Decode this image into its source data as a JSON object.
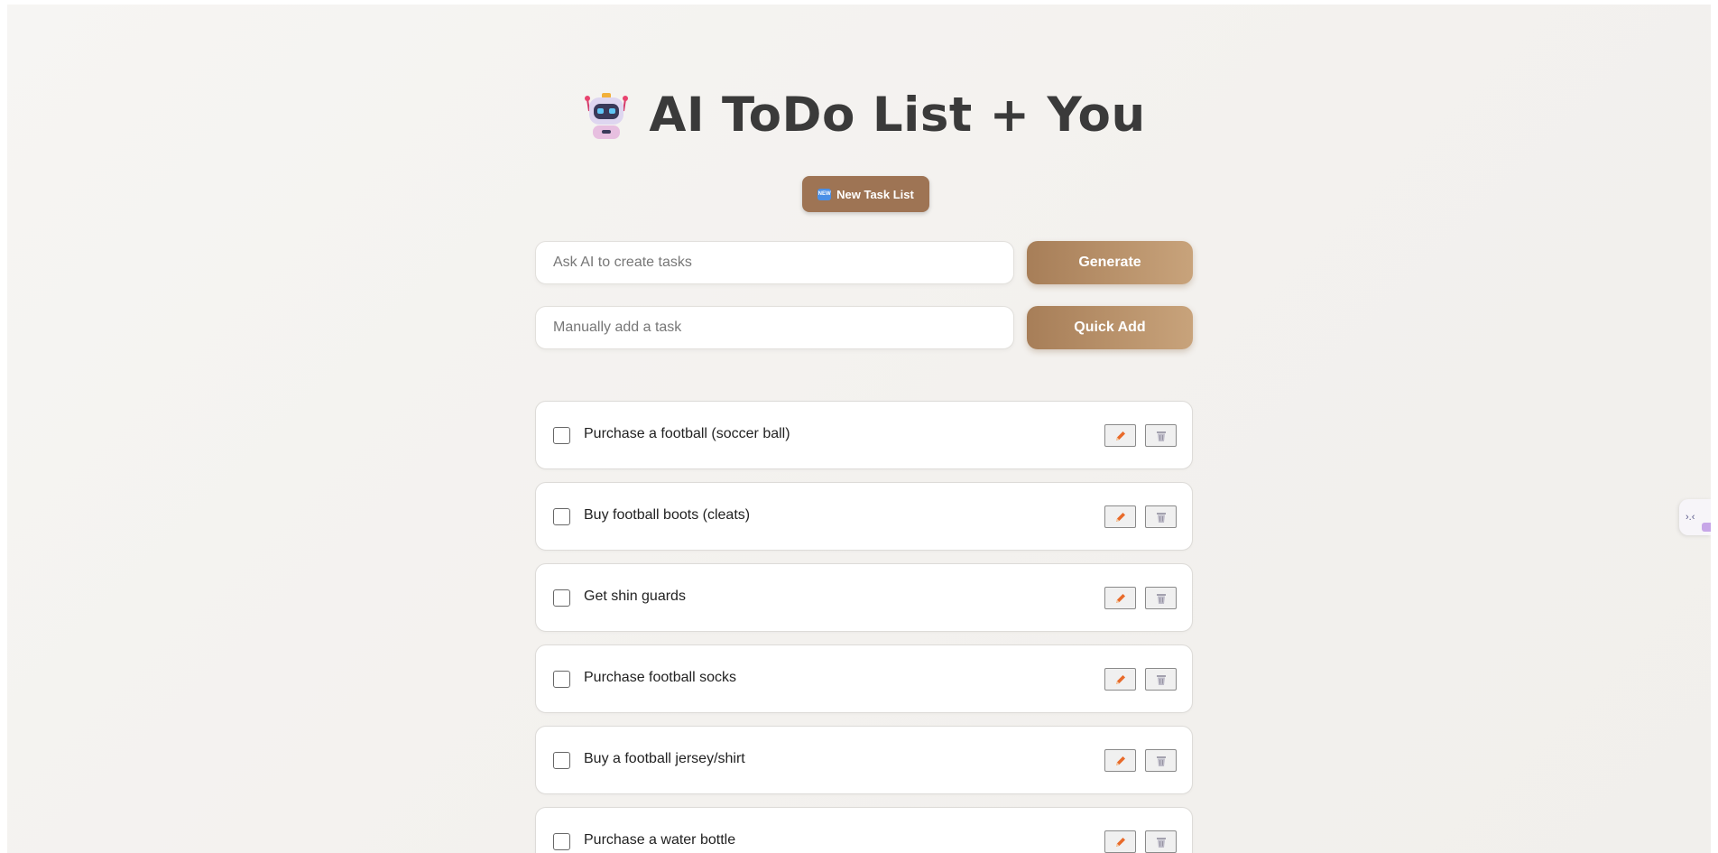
{
  "header": {
    "title": "AI ToDo List + You",
    "icon": "robot-icon"
  },
  "toolbar": {
    "new_list_badge": "NEW",
    "new_list_label": "New Task List"
  },
  "ai_input": {
    "placeholder": "Ask AI to create tasks",
    "value": "",
    "button_label": "Generate"
  },
  "manual_input": {
    "placeholder": "Manually add a task",
    "value": "",
    "button_label": "Quick Add"
  },
  "tasks": [
    {
      "text": "Purchase a football (soccer ball)",
      "done": false
    },
    {
      "text": "Buy football boots (cleats)",
      "done": false
    },
    {
      "text": "Get shin guards",
      "done": false
    },
    {
      "text": "Purchase football socks",
      "done": false
    },
    {
      "text": "Buy a football jersey/shirt",
      "done": false
    },
    {
      "text": "Purchase a water bottle",
      "done": false
    }
  ],
  "side_tab": {
    "label": "›.‹",
    "icon": "collapse-icon"
  },
  "colors": {
    "accent": "#9e7454",
    "button_gradient_start": "#a77e58",
    "button_gradient_end": "#c8a37b",
    "title": "#3a3a3a",
    "background": "#f4f2ef",
    "edit_icon": "#e86a2a",
    "delete_icon": "#9a98a6"
  }
}
